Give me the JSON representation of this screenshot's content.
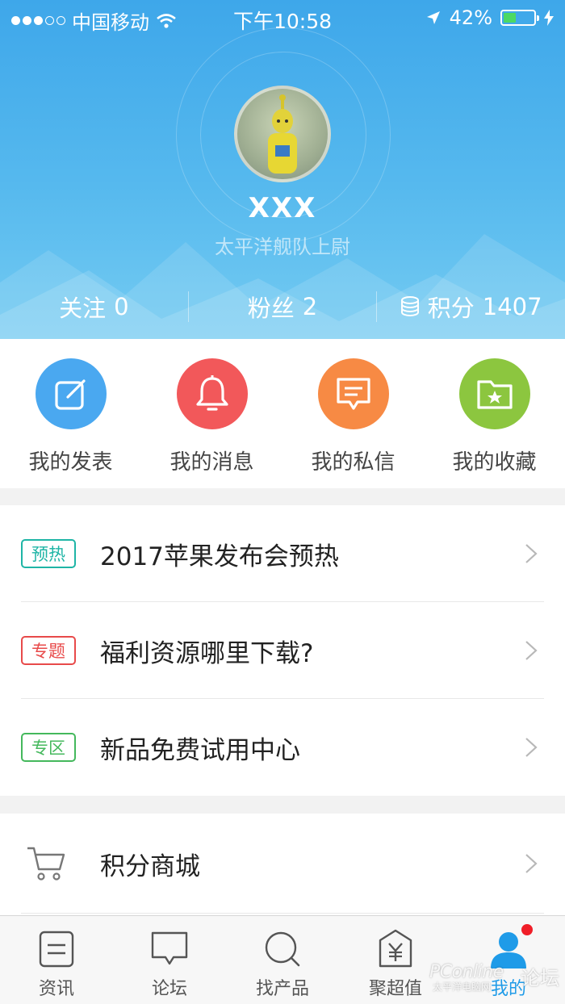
{
  "status_bar": {
    "carrier": "中国移动",
    "time": "下午10:58",
    "battery_percent": "42%",
    "battery_level": 0.42
  },
  "profile": {
    "username": "XXX",
    "rank": "太平洋舰队上尉",
    "avatar_icon": "user-avatar-photo",
    "stats": [
      {
        "label": "关注",
        "value": "0"
      },
      {
        "label": "粉丝",
        "value": "2"
      },
      {
        "label": "积分",
        "value": "1407",
        "icon": "coins-icon"
      }
    ]
  },
  "quick_actions": [
    {
      "label": "我的发表",
      "icon": "edit-icon",
      "color": "#4aa8f0"
    },
    {
      "label": "我的消息",
      "icon": "bell-icon",
      "color": "#f2585a"
    },
    {
      "label": "我的私信",
      "icon": "chat-message-icon",
      "color": "#f78a44"
    },
    {
      "label": "我的收藏",
      "icon": "folder-star-icon",
      "color": "#8cc63f"
    }
  ],
  "promo_items": [
    {
      "tag": "预热",
      "tag_color": "#1fb5a6",
      "title": "2017苹果发布会预热"
    },
    {
      "tag": "专题",
      "tag_color": "#e84a4a",
      "title": "福利资源哪里下载?"
    },
    {
      "tag": "专区",
      "tag_color": "#44b85c",
      "title": "新品免费试用中心"
    }
  ],
  "mall_item": {
    "title": "积分商城",
    "icon": "cart-icon"
  },
  "tabs": [
    {
      "label": "资讯",
      "icon": "news-icon"
    },
    {
      "label": "论坛",
      "icon": "forum-icon"
    },
    {
      "label": "找产品",
      "icon": "search-icon"
    },
    {
      "label": "聚超值",
      "icon": "yuan-tag-icon"
    },
    {
      "label": "我的",
      "icon": "user-icon",
      "active": true,
      "badge": true
    }
  ],
  "colors": {
    "header": "#4aafec",
    "active_tab": "#1f9be8",
    "badge": "#f01e28"
  },
  "watermark": {
    "brand": "PConline",
    "brand_cn": "太平洋电脑网",
    "forum": "论坛"
  }
}
